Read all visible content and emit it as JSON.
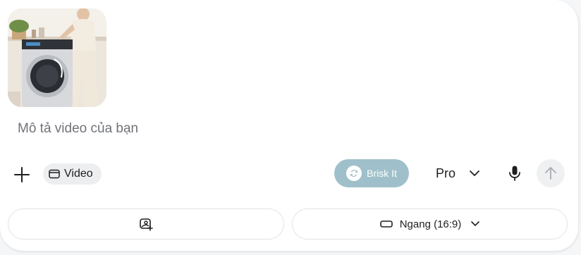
{
  "composer": {
    "prompt_placeholder": "Mô tả video của bạn",
    "attachment": {
      "alt": "washing machine and woman in kitchen",
      "icon": "image-thumbnail"
    }
  },
  "toolbar": {
    "add_icon": "plus-icon",
    "mode_chip_label": "Video",
    "brisk_label": "Brisk It",
    "model_label": "Pro",
    "colors": {
      "brisk_bg": "#9fc0ca",
      "chip_bg": "#eceef0",
      "send_bg": "#eef0f2"
    }
  },
  "bottom": {
    "left_icon": "image-add-icon",
    "aspect_label": "Ngang (16:9)"
  }
}
